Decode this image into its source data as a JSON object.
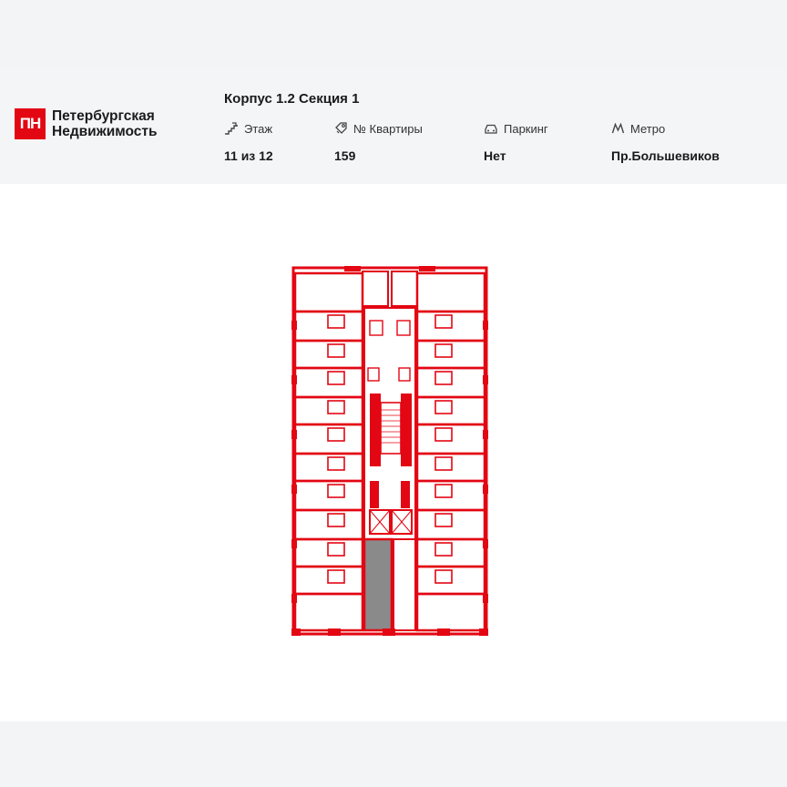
{
  "brand": {
    "mark": "ПН",
    "line1": "Петербургская",
    "line2": "Недвижимость"
  },
  "title": "Корпус 1.2 Секция 1",
  "params": [
    {
      "label": "Этаж",
      "value": "11 из 12",
      "icon": "stairs-icon"
    },
    {
      "label": "№ Квартиры",
      "value": "159",
      "icon": "key-icon"
    },
    {
      "label": "Паркинг",
      "value": "Нет",
      "icon": "car-icon"
    },
    {
      "label": "Метро",
      "value": "Пр.Большевиков",
      "icon": "metro-icon"
    }
  ],
  "colors": {
    "accent": "#e30613",
    "highlight": "#8a8a8a"
  }
}
